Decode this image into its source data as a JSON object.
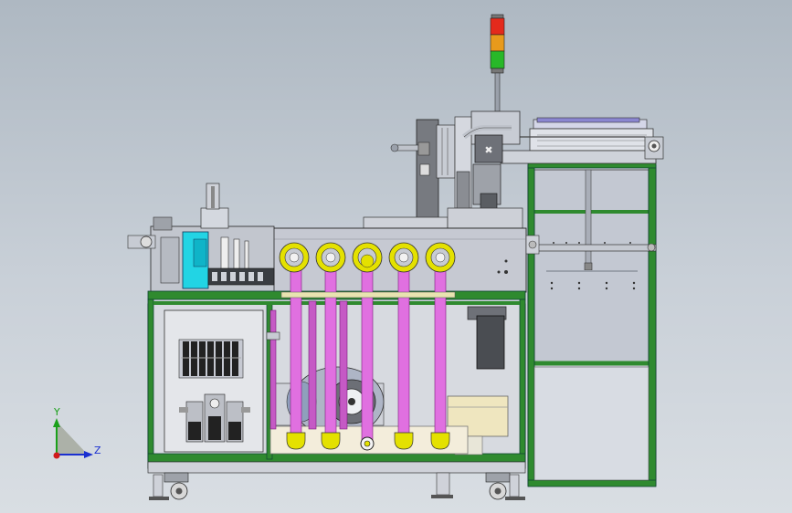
{
  "triad": {
    "y_label": "Y",
    "z_label": "Z"
  },
  "colors": {
    "background_top": "#aeb8c2",
    "frame_green": "#2f8a2f",
    "flange_yellow": "#e4e100",
    "pipe_magenta": "#e070e0",
    "panel_gray": "#c6c9d2",
    "cyan_block": "#00d8e8"
  }
}
